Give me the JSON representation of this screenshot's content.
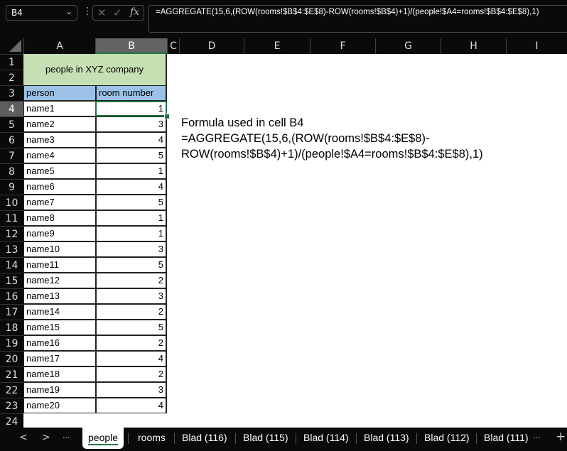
{
  "name_box": {
    "value": "B4"
  },
  "formula_bar": {
    "value": "=AGGREGATE(15,6,(ROW(rooms!$B$4:$E$8)-ROW(rooms!$B$4)+1)/(people!$A4=rooms!$B$4:$E$8),1)"
  },
  "icons": {
    "cancel": "✕",
    "enter": "✓",
    "fx": "fx",
    "chevron": "⌄",
    "more": "⋮"
  },
  "columns": [
    "A",
    "B",
    "C",
    "D",
    "E",
    "F",
    "G",
    "H",
    "I"
  ],
  "rows": [
    "1",
    "2",
    "3",
    "4",
    "5",
    "6",
    "7",
    "8",
    "9",
    "10",
    "11",
    "12",
    "13",
    "14",
    "15",
    "16",
    "17",
    "18",
    "19",
    "20",
    "21",
    "22",
    "23",
    "24"
  ],
  "sheet": {
    "title": "people in XYZ company",
    "header_person": "person",
    "header_room": "room number",
    "data": [
      {
        "person": "name1",
        "room": "1"
      },
      {
        "person": "name2",
        "room": "3"
      },
      {
        "person": "name3",
        "room": "4"
      },
      {
        "person": "name4",
        "room": "5"
      },
      {
        "person": "name5",
        "room": "1"
      },
      {
        "person": "name6",
        "room": "4"
      },
      {
        "person": "name7",
        "room": "5"
      },
      {
        "person": "name8",
        "room": "1"
      },
      {
        "person": "name9",
        "room": "1"
      },
      {
        "person": "name10",
        "room": "3"
      },
      {
        "person": "name11",
        "room": "5"
      },
      {
        "person": "name12",
        "room": "2"
      },
      {
        "person": "name13",
        "room": "3"
      },
      {
        "person": "name14",
        "room": "2"
      },
      {
        "person": "name15",
        "room": "5"
      },
      {
        "person": "name16",
        "room": "2"
      },
      {
        "person": "name17",
        "room": "4"
      },
      {
        "person": "name18",
        "room": "2"
      },
      {
        "person": "name19",
        "room": "3"
      },
      {
        "person": "name20",
        "room": "4"
      }
    ],
    "note_line1": "Formula used in cell B4",
    "note_line2": "=AGGREGATE(15,6,(ROW(rooms!$B$4:$E$8)-",
    "note_line3": "ROW(rooms!$B$4)+1)/(people!$A4=rooms!$B$4:$E$8),1)"
  },
  "tabs": {
    "prev": "<",
    "next": ">",
    "more_left": "···",
    "more_right": "···",
    "add": "+",
    "items": [
      "people",
      "rooms",
      "Blad (116)",
      "Blad (115)",
      "Blad (114)",
      "Blad (113)",
      "Blad (112)",
      "Blad (111)"
    ],
    "active": "people"
  },
  "colors": {
    "accent": "#217346",
    "title_fill": "#c6e0b4",
    "header_fill": "#9bc2e6"
  }
}
